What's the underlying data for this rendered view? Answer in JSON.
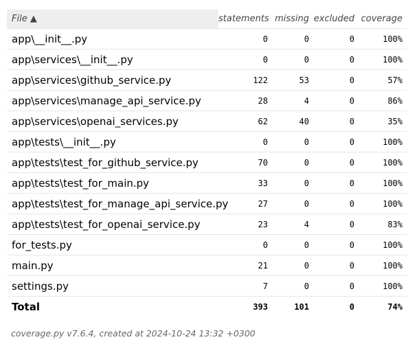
{
  "headers": {
    "file": "File ▲",
    "statements": "statements",
    "missing": "missing",
    "excluded": "excluded",
    "coverage": "coverage"
  },
  "rows": [
    {
      "file": "app\\__init__.py",
      "statements": "0",
      "missing": "0",
      "excluded": "0",
      "coverage": "100%"
    },
    {
      "file": "app\\services\\__init__.py",
      "statements": "0",
      "missing": "0",
      "excluded": "0",
      "coverage": "100%"
    },
    {
      "file": "app\\services\\github_service.py",
      "statements": "122",
      "missing": "53",
      "excluded": "0",
      "coverage": "57%"
    },
    {
      "file": "app\\services\\manage_api_service.py",
      "statements": "28",
      "missing": "4",
      "excluded": "0",
      "coverage": "86%"
    },
    {
      "file": "app\\services\\openai_services.py",
      "statements": "62",
      "missing": "40",
      "excluded": "0",
      "coverage": "35%"
    },
    {
      "file": "app\\tests\\__init__.py",
      "statements": "0",
      "missing": "0",
      "excluded": "0",
      "coverage": "100%"
    },
    {
      "file": "app\\tests\\test_for_github_service.py",
      "statements": "70",
      "missing": "0",
      "excluded": "0",
      "coverage": "100%"
    },
    {
      "file": "app\\tests\\test_for_main.py",
      "statements": "33",
      "missing": "0",
      "excluded": "0",
      "coverage": "100%"
    },
    {
      "file": "app\\tests\\test_for_manage_api_service.py",
      "statements": "27",
      "missing": "0",
      "excluded": "0",
      "coverage": "100%"
    },
    {
      "file": "app\\tests\\test_for_openai_service.py",
      "statements": "23",
      "missing": "4",
      "excluded": "0",
      "coverage": "83%"
    },
    {
      "file": "for_tests.py",
      "statements": "0",
      "missing": "0",
      "excluded": "0",
      "coverage": "100%"
    },
    {
      "file": "main.py",
      "statements": "21",
      "missing": "0",
      "excluded": "0",
      "coverage": "100%"
    },
    {
      "file": "settings.py",
      "statements": "7",
      "missing": "0",
      "excluded": "0",
      "coverage": "100%"
    }
  ],
  "total": {
    "label": "Total",
    "statements": "393",
    "missing": "101",
    "excluded": "0",
    "coverage": "74%"
  },
  "footer": "coverage.py v7.6.4, created at 2024-10-24 13:32 +0300"
}
